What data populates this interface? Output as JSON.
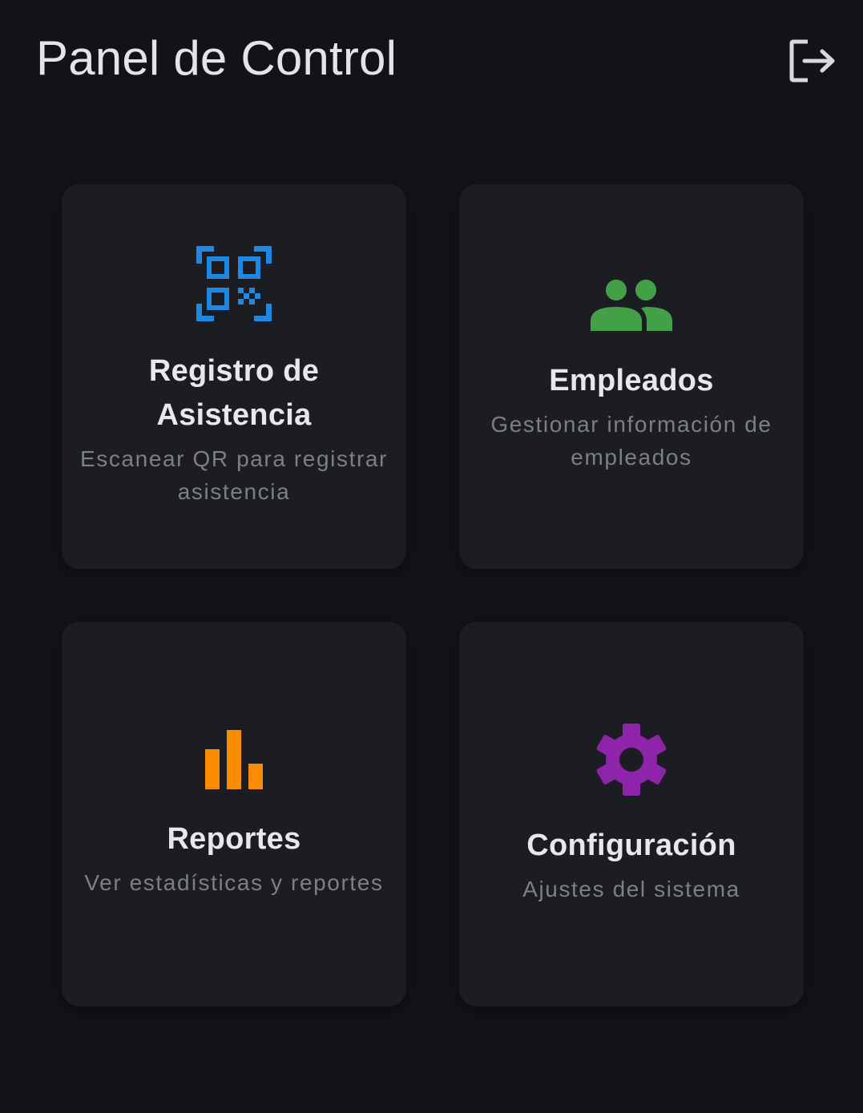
{
  "header": {
    "title": "Panel de Control",
    "logout_icon": "logout-icon"
  },
  "cards": [
    {
      "title": "Registro de Asistencia",
      "description": "Escanear QR para registrar asistencia",
      "icon": "qr-code-scanner-icon",
      "icon_color": "#1e88e5"
    },
    {
      "title": "Empleados",
      "description": "Gestionar información de empleados",
      "icon": "people-icon",
      "icon_color": "#43a047"
    },
    {
      "title": "Reportes",
      "description": "Ver estadísticas y reportes",
      "icon": "bar-chart-icon",
      "icon_color": "#fb8c00"
    },
    {
      "title": "Configuración",
      "description": "Ajustes del sistema",
      "icon": "settings-gear-icon",
      "icon_color": "#8e24aa"
    }
  ],
  "colors": {
    "background": "#111318",
    "card": "#1b1d22",
    "title_text": "#e8e8ea",
    "description_text": "#7c7f86"
  }
}
